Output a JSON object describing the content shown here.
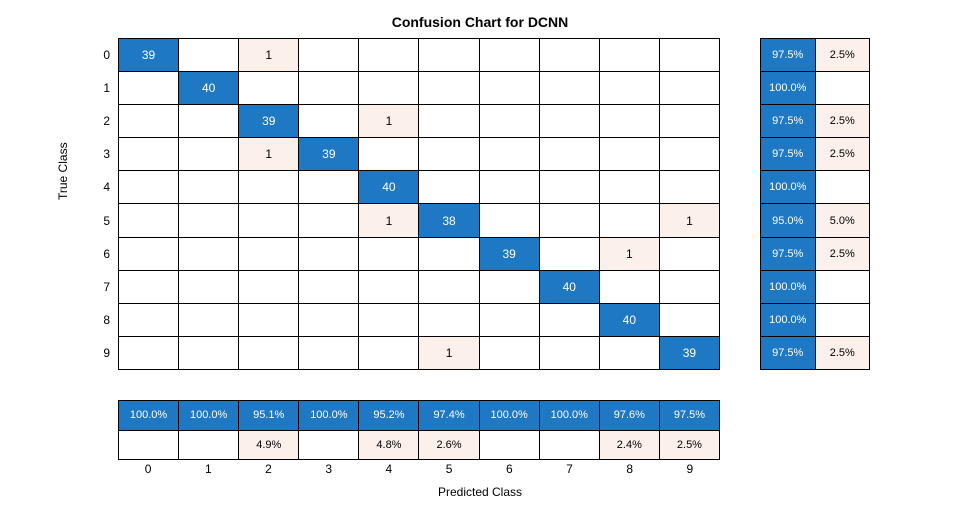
{
  "title": "Confusion Chart for DCNN",
  "ylabel": "True Class",
  "xlabel": "Predicted Class",
  "classes": [
    "0",
    "1",
    "2",
    "3",
    "4",
    "5",
    "6",
    "7",
    "8",
    "9"
  ],
  "chart_data": {
    "type": "heatmap",
    "title": "Confusion Chart for DCNN",
    "xlabel": "Predicted Class",
    "ylabel": "True Class",
    "x_categories": [
      "0",
      "1",
      "2",
      "3",
      "4",
      "5",
      "6",
      "7",
      "8",
      "9"
    ],
    "y_categories": [
      "0",
      "1",
      "2",
      "3",
      "4",
      "5",
      "6",
      "7",
      "8",
      "9"
    ],
    "matrix": [
      [
        39,
        0,
        1,
        0,
        0,
        0,
        0,
        0,
        0,
        0
      ],
      [
        0,
        40,
        0,
        0,
        0,
        0,
        0,
        0,
        0,
        0
      ],
      [
        0,
        0,
        39,
        0,
        1,
        0,
        0,
        0,
        0,
        0
      ],
      [
        0,
        0,
        1,
        39,
        0,
        0,
        0,
        0,
        0,
        0
      ],
      [
        0,
        0,
        0,
        0,
        40,
        0,
        0,
        0,
        0,
        0
      ],
      [
        0,
        0,
        0,
        0,
        1,
        38,
        0,
        0,
        0,
        1
      ],
      [
        0,
        0,
        0,
        0,
        0,
        0,
        39,
        0,
        1,
        0
      ],
      [
        0,
        0,
        0,
        0,
        0,
        0,
        0,
        40,
        0,
        0
      ],
      [
        0,
        0,
        0,
        0,
        0,
        0,
        0,
        0,
        40,
        0
      ],
      [
        0,
        0,
        0,
        0,
        0,
        1,
        0,
        0,
        0,
        39
      ]
    ],
    "row_summary": [
      {
        "correct": "97.5%",
        "incorrect": "2.5%"
      },
      {
        "correct": "100.0%",
        "incorrect": ""
      },
      {
        "correct": "97.5%",
        "incorrect": "2.5%"
      },
      {
        "correct": "97.5%",
        "incorrect": "2.5%"
      },
      {
        "correct": "100.0%",
        "incorrect": ""
      },
      {
        "correct": "95.0%",
        "incorrect": "5.0%"
      },
      {
        "correct": "97.5%",
        "incorrect": "2.5%"
      },
      {
        "correct": "100.0%",
        "incorrect": ""
      },
      {
        "correct": "100.0%",
        "incorrect": ""
      },
      {
        "correct": "97.5%",
        "incorrect": "2.5%"
      }
    ],
    "col_summary": [
      {
        "correct": "100.0%",
        "incorrect": ""
      },
      {
        "correct": "100.0%",
        "incorrect": ""
      },
      {
        "correct": "95.1%",
        "incorrect": "4.9%"
      },
      {
        "correct": "100.0%",
        "incorrect": ""
      },
      {
        "correct": "95.2%",
        "incorrect": "4.8%"
      },
      {
        "correct": "97.4%",
        "incorrect": "2.6%"
      },
      {
        "correct": "100.0%",
        "incorrect": ""
      },
      {
        "correct": "100.0%",
        "incorrect": ""
      },
      {
        "correct": "97.6%",
        "incorrect": "2.4%"
      },
      {
        "correct": "97.5%",
        "incorrect": "2.5%"
      }
    ]
  }
}
